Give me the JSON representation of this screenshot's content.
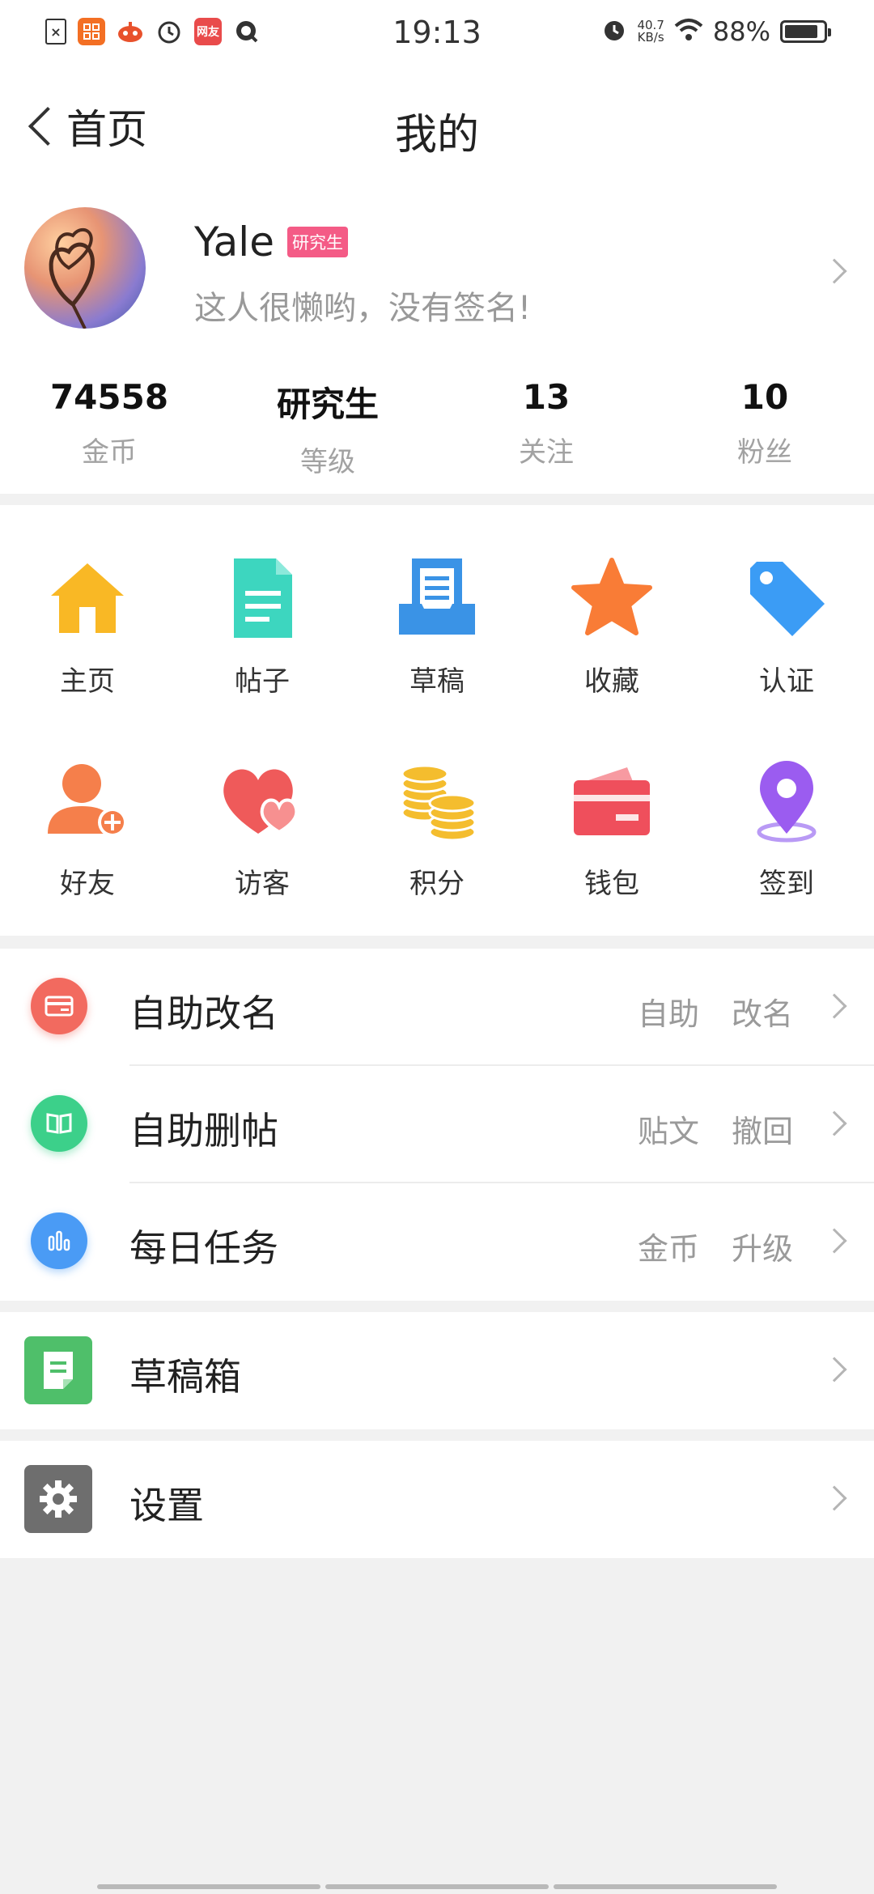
{
  "status_bar": {
    "time": "19:13",
    "net_speed_value": "40.7",
    "net_speed_unit": "KB/s",
    "battery_pct": "88%",
    "battery_level": 0.88,
    "notif_icons": [
      "file-x-icon",
      "app-grid-icon",
      "game-icon",
      "alarm-icon",
      "friend-app-icon",
      "search-app-icon"
    ],
    "notif_friend_text": "网友"
  },
  "nav": {
    "back_label": "首页",
    "title": "我的"
  },
  "profile": {
    "name": "Yale",
    "badge": "研究生",
    "signature": "这人很懒哟，没有签名!"
  },
  "stats": [
    {
      "value": "74558",
      "label": "金币"
    },
    {
      "value": "研究生",
      "label": "等级"
    },
    {
      "value": "13",
      "label": "关注"
    },
    {
      "value": "10",
      "label": "粉丝"
    }
  ],
  "grid": [
    {
      "label": "主页",
      "icon": "home-icon",
      "color": "#f9b825"
    },
    {
      "label": "帖子",
      "icon": "document-icon",
      "color": "#3dd6bf"
    },
    {
      "label": "草稿",
      "icon": "draft-tray-icon",
      "color": "#3a93e6"
    },
    {
      "label": "收藏",
      "icon": "star-icon",
      "color": "#f97c36"
    },
    {
      "label": "认证",
      "icon": "tag-icon",
      "color": "#3b9cf5"
    },
    {
      "label": "好友",
      "icon": "add-friend-icon",
      "color": "#f57f4b"
    },
    {
      "label": "访客",
      "icon": "visitor-heart-icon",
      "color": "#ef5a5a"
    },
    {
      "label": "积分",
      "icon": "coins-icon",
      "color": "#f4bd2e"
    },
    {
      "label": "钱包",
      "icon": "wallet-icon",
      "color": "#ef4f5c"
    },
    {
      "label": "签到",
      "icon": "location-pin-icon",
      "color": "#9b5cf0"
    }
  ],
  "list_group_1": [
    {
      "label": "自助改名",
      "right": [
        "自助",
        "改名"
      ],
      "icon": "rename-card-icon",
      "color": "#f26a5f"
    },
    {
      "label": "自助删帖",
      "right": [
        "贴文",
        "撤回"
      ],
      "icon": "book-icon",
      "color": "#3cd08a"
    },
    {
      "label": "每日任务",
      "right": [
        "金币",
        "升级"
      ],
      "icon": "bar-chart-icon",
      "color": "#4a9bf5"
    }
  ],
  "draft_box": {
    "label": "草稿箱",
    "icon": "draft-box-icon",
    "color": "#4fbf6a"
  },
  "settings": {
    "label": "设置",
    "icon": "gear-icon",
    "color": "#6e6e6e"
  }
}
